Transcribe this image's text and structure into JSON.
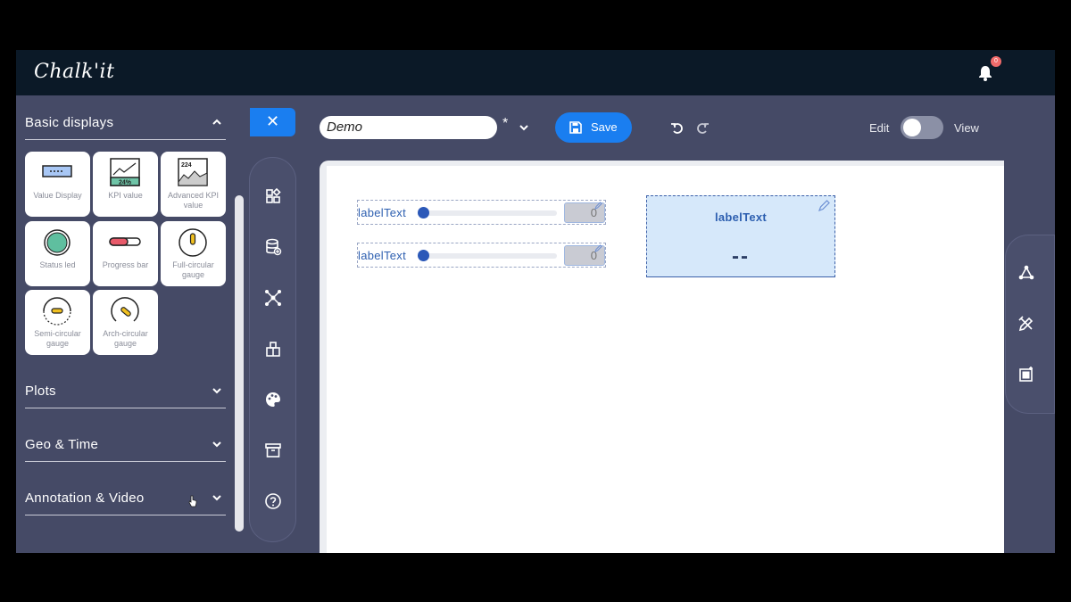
{
  "app": {
    "logo": "Chalk'it",
    "notification_count": "0"
  },
  "left_panel": {
    "sections": [
      {
        "title": "Basic displays",
        "expanded": true
      },
      {
        "title": "Plots",
        "expanded": false
      },
      {
        "title": "Geo & Time",
        "expanded": false
      },
      {
        "title": "Annotation & Video",
        "expanded": false
      }
    ],
    "widgets": [
      {
        "label": "Value Display",
        "icon": "value-display-icon"
      },
      {
        "label": "KPI value",
        "icon": "kpi-value-icon",
        "icon_text": "24%"
      },
      {
        "label": "Advanced KPI value",
        "icon": "advanced-kpi-icon",
        "icon_text": "224"
      },
      {
        "label": "Status led",
        "icon": "status-led-icon"
      },
      {
        "label": "Progress bar",
        "icon": "progress-bar-icon"
      },
      {
        "label": "Full-circular gauge",
        "icon": "full-circular-gauge-icon"
      },
      {
        "label": "Semi-circular gauge",
        "icon": "semi-circular-gauge-icon"
      },
      {
        "label": "Arch-circular gauge",
        "icon": "arch-circular-gauge-icon"
      }
    ]
  },
  "toolbar": {
    "close_label": "✕",
    "file_name": "Demo",
    "modified_marker": "*",
    "save_label": "Save",
    "edit_label": "Edit",
    "view_label": "View",
    "mode": "Edit"
  },
  "tool_rail": [
    "widgets-icon",
    "datanodes-icon",
    "graph-icon",
    "libraries-icon",
    "theme-icon",
    "archive-icon",
    "help-icon"
  ],
  "right_rail": [
    "connect-icon",
    "format-icon",
    "aspect-icon"
  ],
  "canvas": {
    "sliders": [
      {
        "label": "labelText",
        "value": "0"
      },
      {
        "label": "labelText",
        "value": "0"
      }
    ],
    "value_display": {
      "label": "labelText",
      "value": "--"
    }
  },
  "colors": {
    "accent": "#1a7ef0",
    "topbar": "#0b1927",
    "panel": "#454a66",
    "widget_text": "#2d5fb0",
    "value_bg": "#d6e8fa"
  }
}
